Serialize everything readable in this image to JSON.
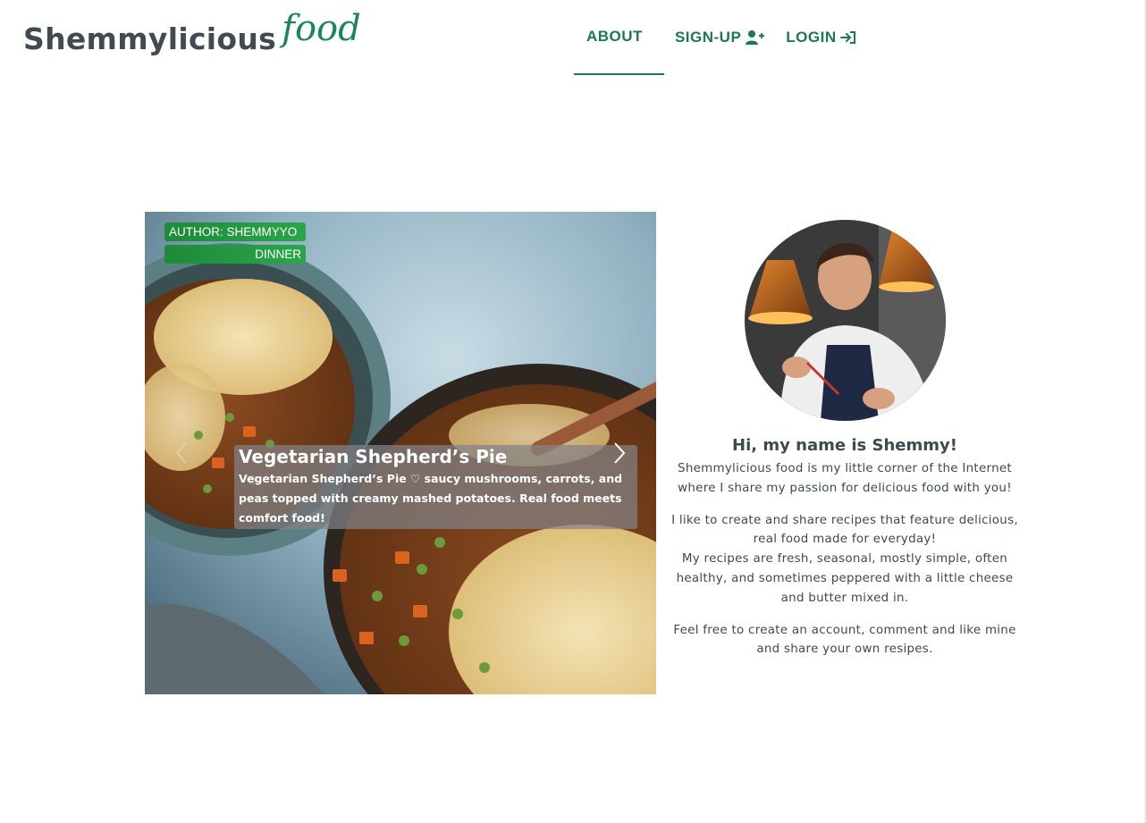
{
  "header": {
    "logo_main": "Shemmylicious",
    "logo_script": "food",
    "nav": [
      {
        "label": "ABOUT",
        "icon": "none",
        "active": true
      },
      {
        "label": "SIGN-UP",
        "icon": "user-plus-icon",
        "active": false
      },
      {
        "label": "LOGIN",
        "icon": "login-icon",
        "active": false
      }
    ]
  },
  "carousel": {
    "author_badge": "AUTHOR: SHEMMYYO",
    "category_badge": "DINNER",
    "title": "Vegetarian Shepherd’s Pie",
    "description": "Vegetarian Shepherd’s Pie ♡ saucy mushrooms, carrots, and peas topped with creamy mashed potatoes. Real food meets comfort food!"
  },
  "about": {
    "heading": "Hi, my name is Shemmy!",
    "p1": "Shemmylicious food is my little corner of the Internet where I share my passion for delicious food with you!",
    "p2_line1": "I like to create and share recipes that feature delicious, real food made for everyday!",
    "p2_line2": "My recipes are fresh, seasonal, mostly simple, often healthy, and sometimes peppered with a little cheese and butter mixed in.",
    "p3": "Feel free to create an account, comment and like mine and share your own resipes."
  },
  "colors": {
    "brand_green": "#1c7a4e",
    "badge_green": "#1e8a3a",
    "text": "#3d4a4f"
  }
}
